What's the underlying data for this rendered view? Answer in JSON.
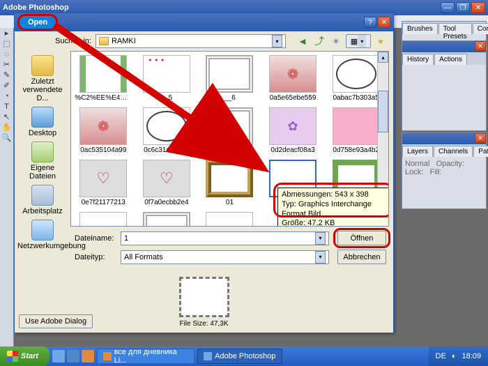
{
  "ps": {
    "title": "Adobe Photoshop",
    "panels": {
      "p1_tabs": [
        "Brushes",
        "Tool Presets",
        "Comps"
      ],
      "p2_tabs": [
        "History",
        "Actions"
      ],
      "p3_tabs": [
        "Layers",
        "Channels",
        "Paths"
      ],
      "p3_body1": "Normal",
      "p3_body2": "Opacity:",
      "p3_body3": "Lock:",
      "p3_body4": "Fill:"
    }
  },
  "dlg": {
    "title": "Open",
    "lookin_label": "Suchen in:",
    "lookin_value": "RAMKI",
    "places": {
      "recent": "Zuletzt verwendete D...",
      "desktop": "Desktop",
      "mydocs": "Eigene Dateien",
      "computer": "Arbeitsplatz",
      "network": "Netzwerkumgebung"
    },
    "items": [
      {
        "name": "%C2%EE%E4%ED…",
        "cls": "t-green"
      },
      {
        "name": "__5",
        "cls": "t-stars"
      },
      {
        "name": "__6",
        "cls": "t-ornate"
      },
      {
        "name": "0a5e65ebe559",
        "cls": "t-pic"
      },
      {
        "name": "0abac7b303a5",
        "cls": "t-oval"
      },
      {
        "name": "0ac535104a99",
        "cls": "t-pic"
      },
      {
        "name": "0c6c31ab6e6d",
        "cls": "t-oval"
      },
      {
        "name": "0c63fb262a18c",
        "cls": "t-ornate"
      },
      {
        "name": "0d2deacf08a3",
        "cls": "t-fairy"
      },
      {
        "name": "0d758e93a4b2",
        "cls": "t-pink"
      },
      {
        "name": "0e7f21177213",
        "cls": "t-love"
      },
      {
        "name": "0f7a0ecbb2e4",
        "cls": "t-love"
      },
      {
        "name": "01",
        "cls": "t-gold"
      },
      {
        "name": "1",
        "cls": "t-dash",
        "selected": true
      },
      {
        "name": "",
        "cls": "t-greenfr"
      },
      {
        "name": "",
        "cls": "t-ribbon"
      },
      {
        "name": "",
        "cls": "t-ornate"
      },
      {
        "name": "",
        "cls": "t-roses"
      }
    ],
    "tooltip": {
      "l1": "Abmessungen: 543 x 398",
      "l2": "Typ: Graphics Interchange Format Bild",
      "l3": "Größe: 47,2 KB"
    },
    "filename_label": "Dateiname:",
    "filename_value": "1",
    "filetype_label": "Dateityp:",
    "filetype_value": "All Formats",
    "open_btn": "Öffnen",
    "cancel_btn": "Abbrechen",
    "preview_label": "File Size: 47,3K",
    "adobe_btn": "Use Adobe Dialog"
  },
  "taskbar": {
    "start": "Start",
    "task1": "все для дневника Li...",
    "task2": "Adobe Photoshop",
    "lang": "DE",
    "time": "18:09"
  }
}
